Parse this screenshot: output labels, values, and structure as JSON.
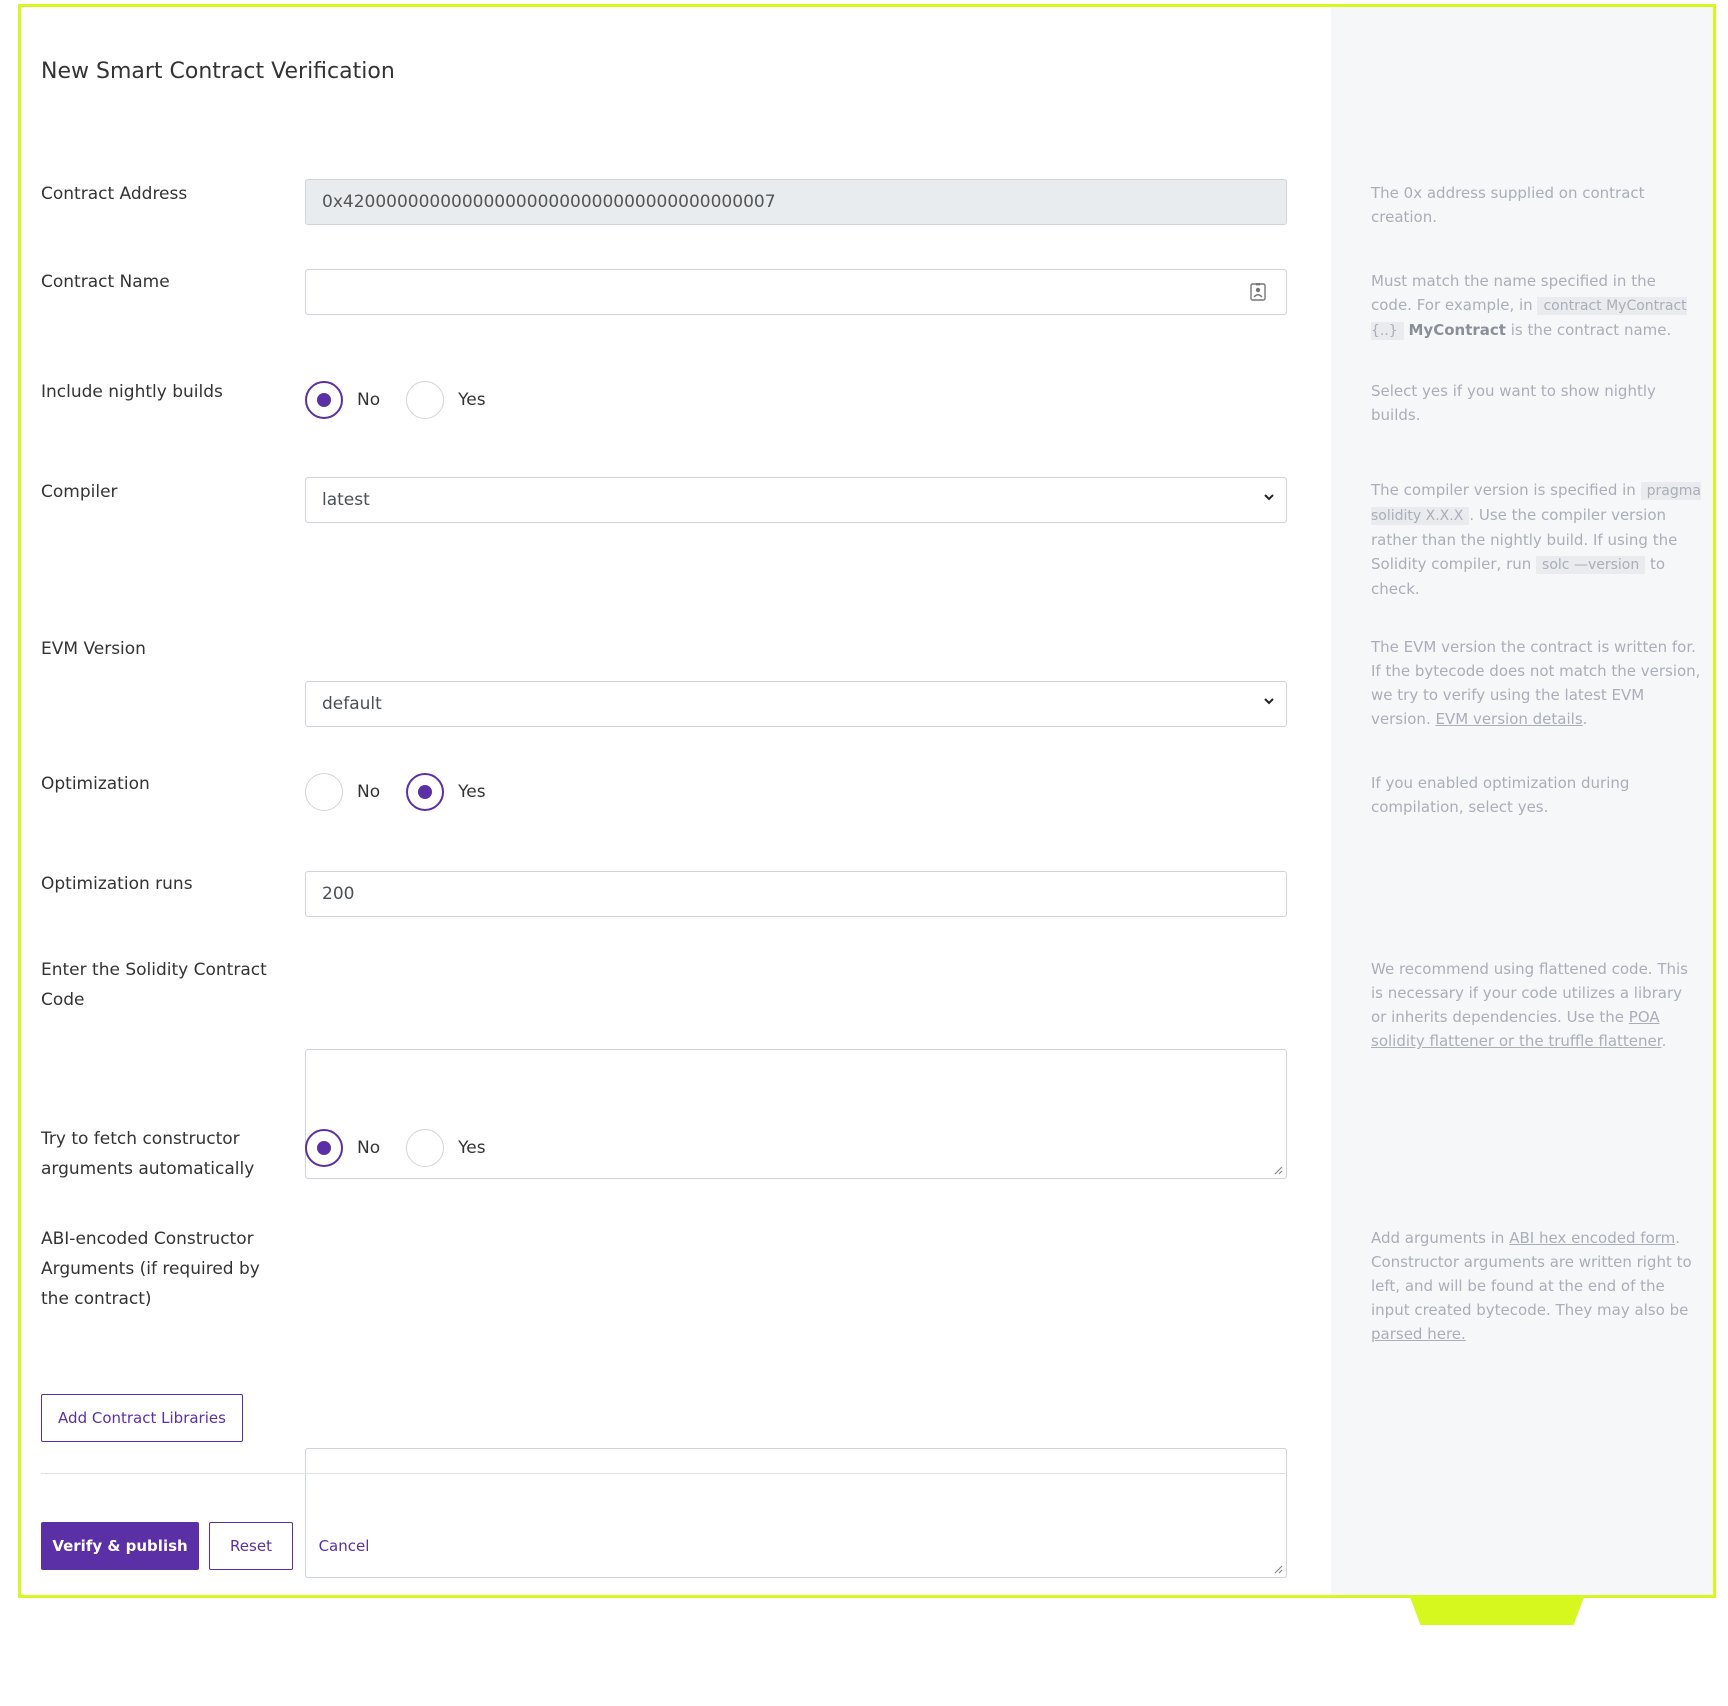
{
  "title": "New Smart Contract Verification",
  "fields": {
    "contract_address": {
      "label": "Contract Address",
      "value": "0x4200000000000000000000000000000000000007",
      "help": "The 0x address supplied on contract creation."
    },
    "contract_name": {
      "label": "Contract Name",
      "value": "",
      "help_prefix": "Must match the name specified in the code. For example, in",
      "help_code": "contract MyContract {..}",
      "help_bold": "MyContract",
      "help_suffix": "is the contract name."
    },
    "nightly_builds": {
      "label": "Include nightly builds",
      "options": [
        "No",
        "Yes"
      ],
      "selected": "No",
      "help": "Select yes if you want to show nightly builds."
    },
    "compiler": {
      "label": "Compiler",
      "value": "latest",
      "help_1": "The compiler version is specified in",
      "help_code_1": "pragma solidity X.X.X",
      "help_2": ". Use the compiler version rather than the nightly build. If using the Solidity compiler, run",
      "help_code_2": "solc —version",
      "help_3": "to check."
    },
    "evm_version": {
      "label": "EVM Version",
      "value": "default",
      "help": "The EVM version the contract is written for. If the bytecode does not match the version, we try to verify using the latest EVM version.",
      "help_link": "EVM version details",
      "help_end": "."
    },
    "optimization": {
      "label": "Optimization",
      "options": [
        "No",
        "Yes"
      ],
      "selected": "Yes",
      "help": "If you enabled optimization during compilation, select yes."
    },
    "optimization_runs": {
      "label": "Optimization runs",
      "value": "200"
    },
    "contract_code": {
      "label": "Enter the Solidity Contract Code",
      "value": "",
      "help": "We recommend using flattened code. This is necessary if your code utilizes a library or inherits dependencies. Use the",
      "help_link": "POA solidity flattener or the truffle flattener",
      "help_end": "."
    },
    "fetch_constructor": {
      "label": "Try to fetch constructor arguments automatically",
      "options": [
        "No",
        "Yes"
      ],
      "selected": "No"
    },
    "constructor_args": {
      "label": "ABI-encoded Constructor Arguments (if required by the contract)",
      "value": "",
      "help_1": "Add arguments in",
      "help_link_1": "ABI hex encoded form",
      "help_2": ". Constructor arguments are written right to left, and will be found at the end of the input created bytecode. They may also be",
      "help_link_2": "parsed here."
    }
  },
  "buttons": {
    "add_libraries": "Add Contract Libraries",
    "verify": "Verify & publish",
    "reset": "Reset",
    "cancel": "Cancel"
  },
  "colors": {
    "accent": "#5b2fa6",
    "frame": "#d7f81f",
    "side_panel": "#f6f7f9"
  },
  "icons": [
    "contact-card-icon",
    "chevron-down-icon",
    "resize-grip-icon"
  ]
}
